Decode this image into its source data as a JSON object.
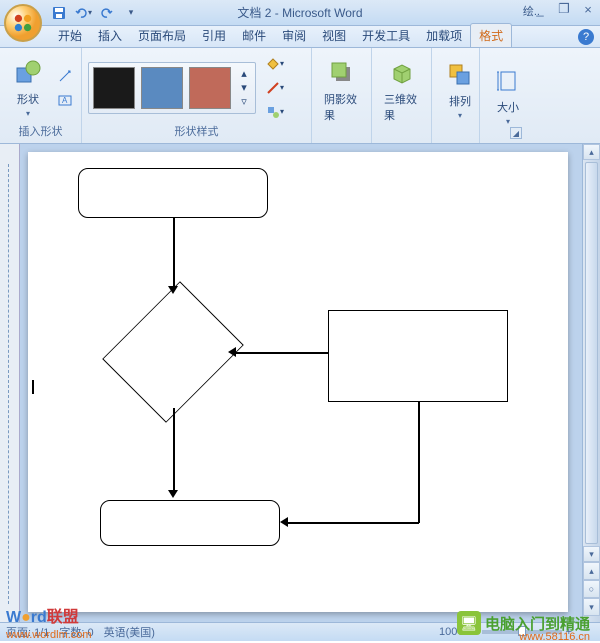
{
  "title": "文档 2 - Microsoft Word",
  "context_tab": "绘..",
  "qat": {
    "save": "save",
    "undo": "undo",
    "redo": "redo"
  },
  "window_controls": {
    "minimize": "_",
    "restore": "❐",
    "close": "×"
  },
  "tabs": {
    "items": [
      {
        "label": "开始"
      },
      {
        "label": "插入"
      },
      {
        "label": "页面布局"
      },
      {
        "label": "引用"
      },
      {
        "label": "邮件"
      },
      {
        "label": "审阅"
      },
      {
        "label": "视图"
      },
      {
        "label": "开发工具"
      },
      {
        "label": "加载项"
      },
      {
        "label": "格式"
      }
    ],
    "active_index": 9,
    "help": "?"
  },
  "ribbon": {
    "groups": [
      {
        "label": "插入形状",
        "shapes_btn": "形状"
      },
      {
        "label": "形状样式",
        "fill": "填充",
        "outline": "轮廓",
        "change": "更改"
      },
      {
        "label": "",
        "shadow_btn": "阴影效果"
      },
      {
        "label": "",
        "threed_btn": "三维效果"
      },
      {
        "label": "",
        "arrange_btn": "排列"
      },
      {
        "label": "",
        "size_btn": "大小"
      }
    ]
  },
  "status": {
    "page": "页面: 1/1",
    "words": "字数: 0",
    "lang": "英语(美国)",
    "zoom": "100%"
  },
  "watermarks": {
    "w1a": "W",
    "w1b": "rd",
    "w1c": "联盟",
    "url1": "www.wordlm.com",
    "w2": "电脑入门到精通",
    "url2": "www.58116.cn"
  }
}
